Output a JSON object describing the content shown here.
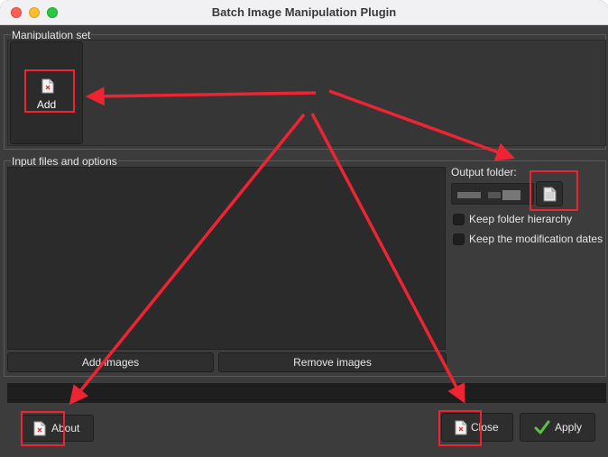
{
  "window": {
    "title": "Batch Image Manipulation Plugin"
  },
  "manipulation": {
    "group_label": "Manipulation set",
    "add_label": "Add",
    "add_icon": "document-missing-icon"
  },
  "input": {
    "group_label": "Input files and options",
    "add_images_label": "Add images",
    "remove_images_label": "Remove images"
  },
  "output": {
    "label": "Output folder:",
    "browse_icon": "folder-browse-icon",
    "keep_hierarchy_label": "Keep folder hierarchy",
    "keep_hierarchy_checked": false,
    "keep_dates_label": "Keep the modification dates",
    "keep_dates_checked": false
  },
  "footer": {
    "about_label": "About",
    "close_label": "Close",
    "apply_label": "Apply"
  },
  "annotation": {
    "color": "#ee2433"
  }
}
